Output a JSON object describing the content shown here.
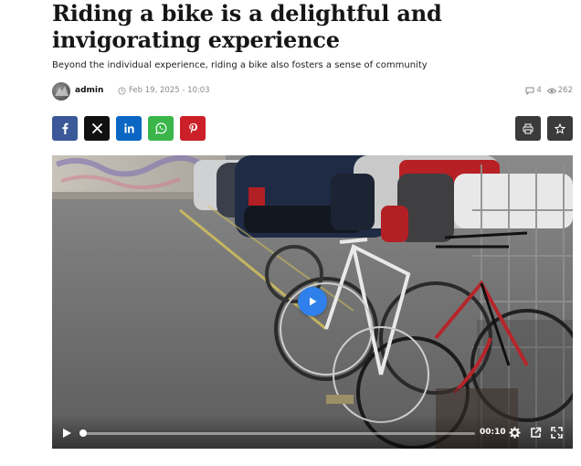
{
  "article": {
    "title": "Riding a bike is a delightful and invigorating experience",
    "subtitle": "Beyond the individual experience, riding a bike also fosters a sense of community",
    "author": "admin",
    "date": "Feb 19, 2025 - 10:03",
    "comments": "4",
    "views": "262"
  },
  "share": [
    {
      "name": "facebook",
      "icon": "facebook-icon",
      "color": "#3b5998"
    },
    {
      "name": "x",
      "icon": "x-icon",
      "color": "#111111"
    },
    {
      "name": "linkedin",
      "icon": "linkedin-icon",
      "color": "#0a66c2"
    },
    {
      "name": "whatsapp",
      "icon": "whatsapp-icon",
      "color": "#3ab54a"
    },
    {
      "name": "pinterest",
      "icon": "pinterest-icon",
      "color": "#cb2027"
    }
  ],
  "tools": [
    {
      "name": "print",
      "icon": "print-icon"
    },
    {
      "name": "bookmark",
      "icon": "star-icon"
    }
  ],
  "video": {
    "time": "00:10",
    "progress": 0.0,
    "accent": "#2f80ea"
  }
}
